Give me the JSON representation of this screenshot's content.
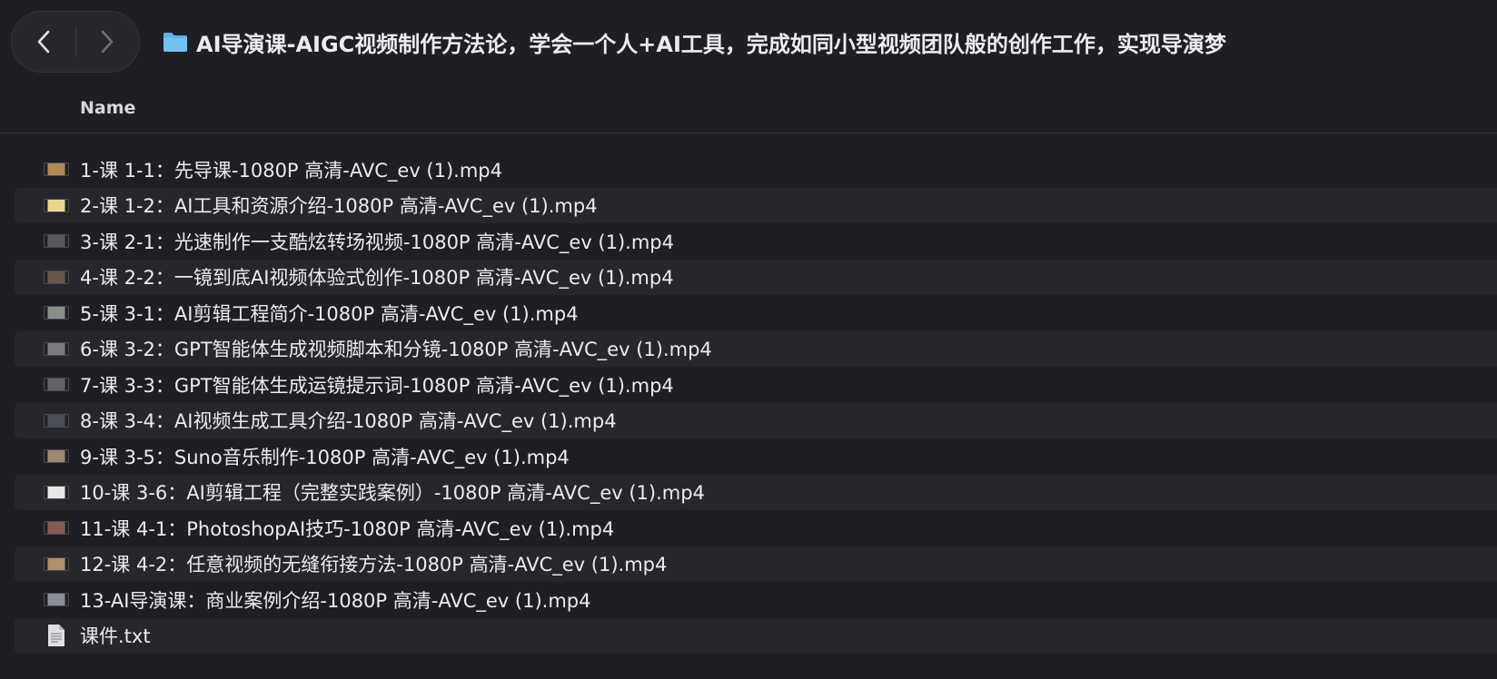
{
  "toolbar": {
    "back_icon": "chevron-left-icon",
    "forward_icon": "chevron-right-icon",
    "folder_icon": "folder-icon",
    "title": "AI导演课-AIGC视频制作方法论，学会一个人+AI工具，完成如同小型视频团队般的创作工作，实现导演梦"
  },
  "header": {
    "name_label": "Name"
  },
  "files": [
    {
      "name": "1-课 1-1：先导课-1080P 高清-AVC_ev (1).mp4",
      "icon": "video-thumbnail-icon",
      "thumb_color": "#b08a55"
    },
    {
      "name": "2-课 1-2：AI工具和资源介绍-1080P 高清-AVC_ev (1).mp4",
      "icon": "video-thumbnail-icon",
      "thumb_color": "#e8d98a"
    },
    {
      "name": "3-课 2-1：光速制作一支酷炫转场视频-1080P 高清-AVC_ev (1).mp4",
      "icon": "video-thumbnail-icon",
      "thumb_color": "#555a60"
    },
    {
      "name": "4-课 2-2：一镜到底AI视频体验式创作-1080P 高清-AVC_ev (1).mp4",
      "icon": "video-thumbnail-icon",
      "thumb_color": "#6a5548"
    },
    {
      "name": "5-课 3-1：AI剪辑工程简介-1080P 高清-AVC_ev (1).mp4",
      "icon": "video-thumbnail-icon",
      "thumb_color": "#8a8f8a"
    },
    {
      "name": "6-课 3-2：GPT智能体生成视频脚本和分镜-1080P 高清-AVC_ev (1).mp4",
      "icon": "video-thumbnail-icon",
      "thumb_color": "#7a7c80"
    },
    {
      "name": "7-课 3-3：GPT智能体生成运镜提示词-1080P 高清-AVC_ev (1).mp4",
      "icon": "video-thumbnail-icon",
      "thumb_color": "#606468"
    },
    {
      "name": "8-课 3-4：AI视频生成工具介绍-1080P 高清-AVC_ev (1).mp4",
      "icon": "video-thumbnail-icon",
      "thumb_color": "#4a4e55"
    },
    {
      "name": "9-课 3-5：Suno音乐制作-1080P 高清-AVC_ev (1).mp4",
      "icon": "video-thumbnail-icon",
      "thumb_color": "#a08870"
    },
    {
      "name": "10-课 3-6：AI剪辑工程（完整实践案例）-1080P 高清-AVC_ev (1).mp4",
      "icon": "video-thumbnail-icon",
      "thumb_color": "#e8e8ea"
    },
    {
      "name": "11-课 4-1：PhotoshopAI技巧-1080P 高清-AVC_ev (1).mp4",
      "icon": "video-thumbnail-icon",
      "thumb_color": "#8a5a55"
    },
    {
      "name": "12-课 4-2：任意视频的无缝衔接方法-1080P 高清-AVC_ev (1).mp4",
      "icon": "video-thumbnail-icon",
      "thumb_color": "#b0906a"
    },
    {
      "name": "13-AI导演课：商业案例介绍-1080P 高清-AVC_ev (1).mp4",
      "icon": "video-thumbnail-icon",
      "thumb_color": "#8a8e95"
    },
    {
      "name": "课件.txt",
      "icon": "text-document-icon",
      "thumb_color": "#e0e0e2"
    }
  ]
}
